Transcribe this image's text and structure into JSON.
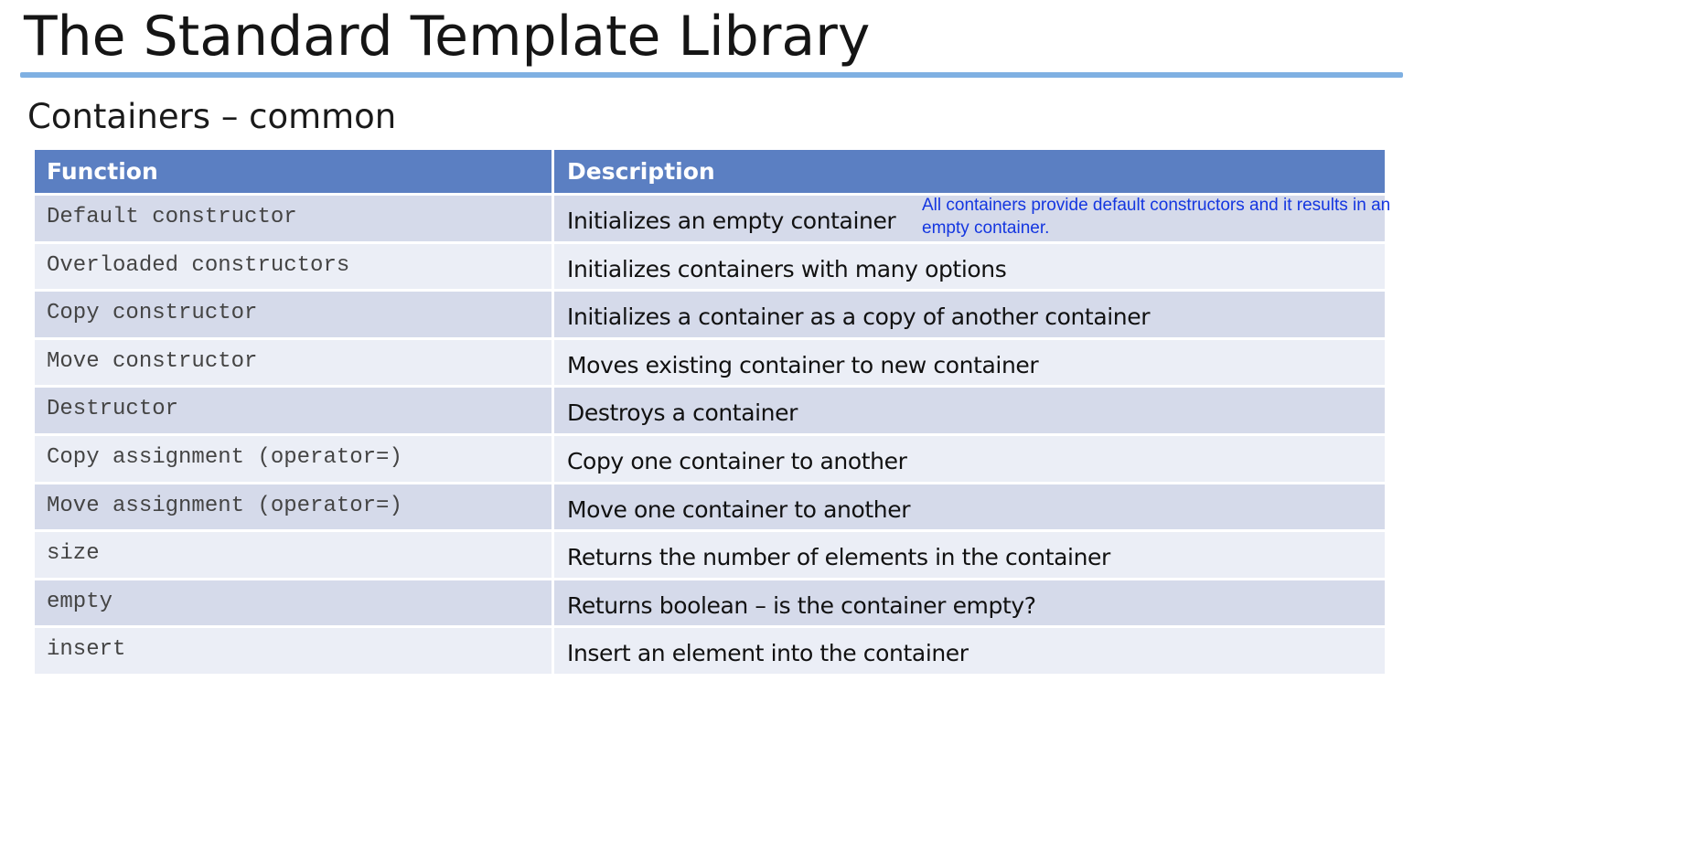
{
  "slide": {
    "title": "The Standard Template Library",
    "subtitle": "Containers – common"
  },
  "table": {
    "headers": [
      "Function",
      "Description"
    ],
    "rows": [
      {
        "function": "Default constructor",
        "description": "Initializes an empty container"
      },
      {
        "function": "Overloaded constructors",
        "description": "Initializes containers with many options"
      },
      {
        "function": "Copy constructor",
        "description": "Initializes a container as a copy of another container"
      },
      {
        "function": "Move constructor",
        "description": "Moves existing container to new container"
      },
      {
        "function": "Destructor",
        "description": "Destroys a container"
      },
      {
        "function": "Copy assignment (operator=)",
        "description": "Copy one container to another"
      },
      {
        "function": "Move assignment (operator=)",
        "description": "Move one container to another"
      },
      {
        "function": "size",
        "description": "Returns the number of elements in the container"
      },
      {
        "function": "empty",
        "description": "Returns boolean – is the container empty?"
      },
      {
        "function": "insert",
        "description": "Insert an element into the container"
      }
    ]
  },
  "annotation": {
    "text": "All containers provide default constructors and it results in an empty container."
  },
  "colors": {
    "title_rule": "#7fb0e2",
    "header_bg": "#5b7fc2",
    "row_odd": "#d5daea",
    "row_even": "#ebeef6",
    "annotation_text": "#1436e0"
  }
}
